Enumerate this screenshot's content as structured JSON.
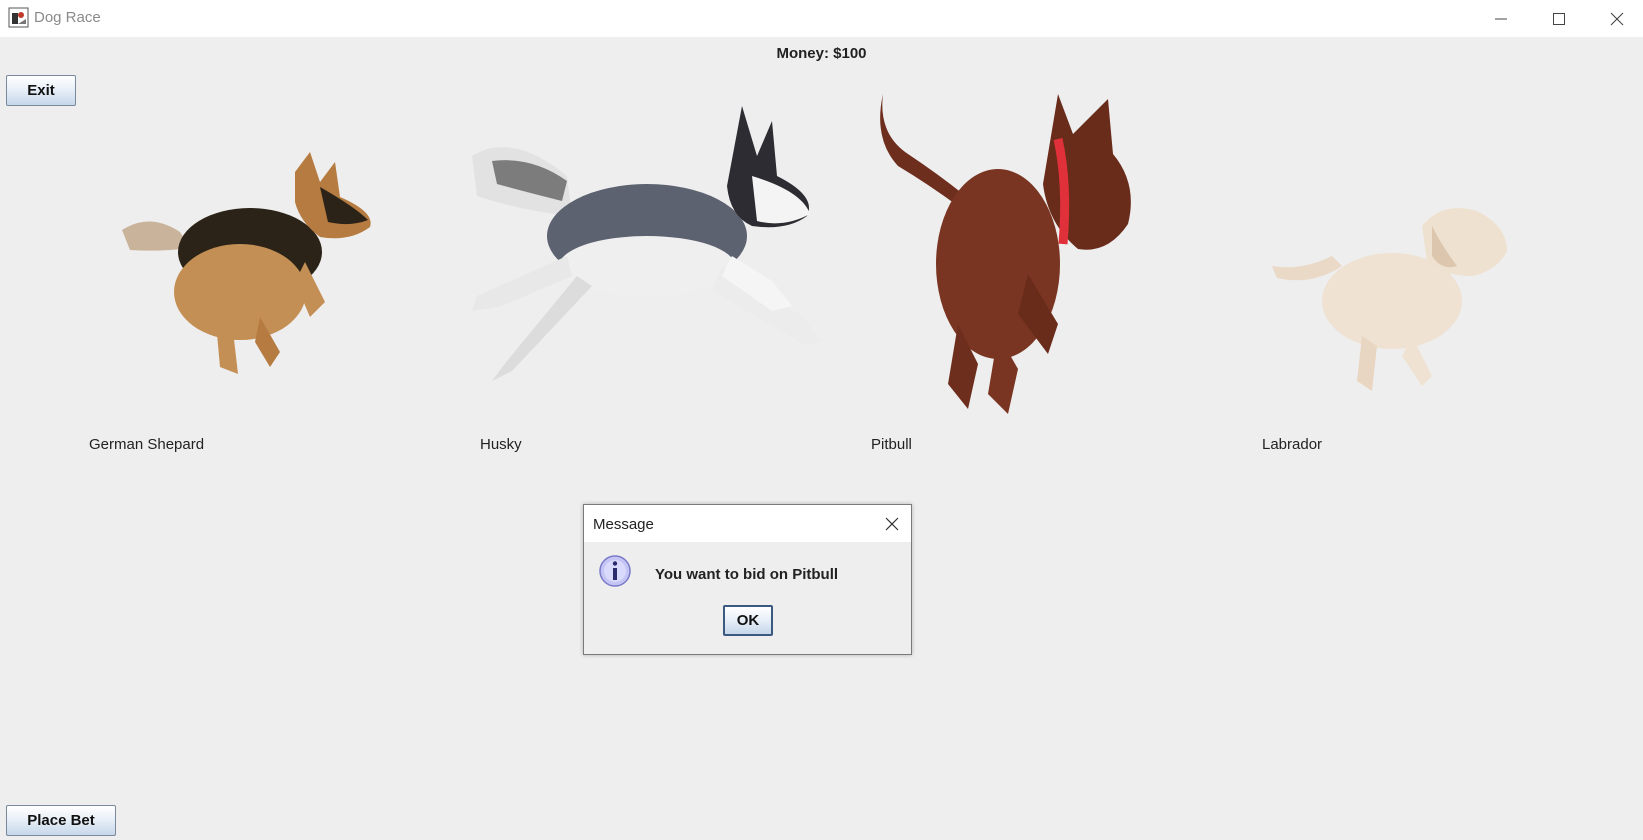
{
  "window": {
    "title": "Dog Race",
    "app_icon": "java-duke-icon",
    "controls": [
      "minimize-icon",
      "maximize-icon",
      "close-icon"
    ]
  },
  "money_label": "Money: $100",
  "buttons": {
    "exit": "Exit",
    "place_bet": "Place Bet"
  },
  "dogs": [
    {
      "name": "German Shepard",
      "image": "german-shepherd-running"
    },
    {
      "name": "Husky",
      "image": "husky-running"
    },
    {
      "name": "Pitbull",
      "image": "pitbull-running"
    },
    {
      "name": "Labrador",
      "image": "labrador-running"
    }
  ],
  "dialog": {
    "title": "Message",
    "icon": "info-icon",
    "message": "You want to bid on Pitbull",
    "ok_label": "OK"
  },
  "colors": {
    "background": "#eeeeee",
    "button_border": "#7a8a9c",
    "info_icon": "#b9b9f2"
  }
}
